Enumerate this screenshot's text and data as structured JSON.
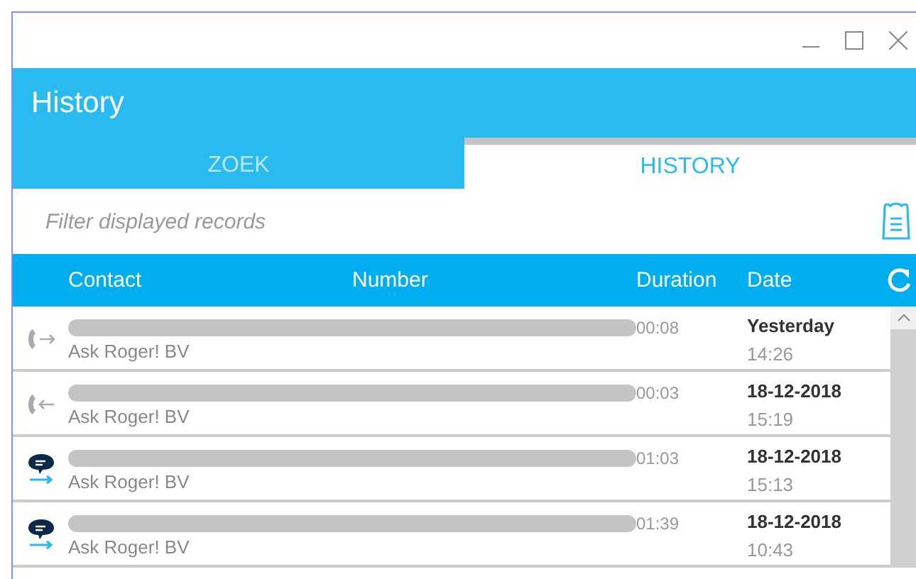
{
  "window": {
    "title": "History"
  },
  "tabs": [
    {
      "label": "ZOEK",
      "selected": false
    },
    {
      "label": "HISTORY",
      "selected": true
    }
  ],
  "filter": {
    "placeholder": "Filter displayed records"
  },
  "table": {
    "columns": [
      "Contact",
      "Number",
      "Duration",
      "Date"
    ],
    "rows": [
      {
        "kind": "call_out",
        "company": "Ask Roger! BV",
        "duration": "00:08",
        "date": "Yesterday",
        "time": "14:26"
      },
      {
        "kind": "call_in",
        "company": "Ask Roger! BV",
        "duration": "00:03",
        "date": "18-12-2018",
        "time": "15:19"
      },
      {
        "kind": "chat",
        "company": "Ask Roger! BV",
        "duration": "01:03",
        "date": "18-12-2018",
        "time": "15:13"
      },
      {
        "kind": "chat",
        "company": "Ask Roger! BV",
        "duration": "01:39",
        "date": "18-12-2018",
        "time": "10:43"
      }
    ]
  }
}
